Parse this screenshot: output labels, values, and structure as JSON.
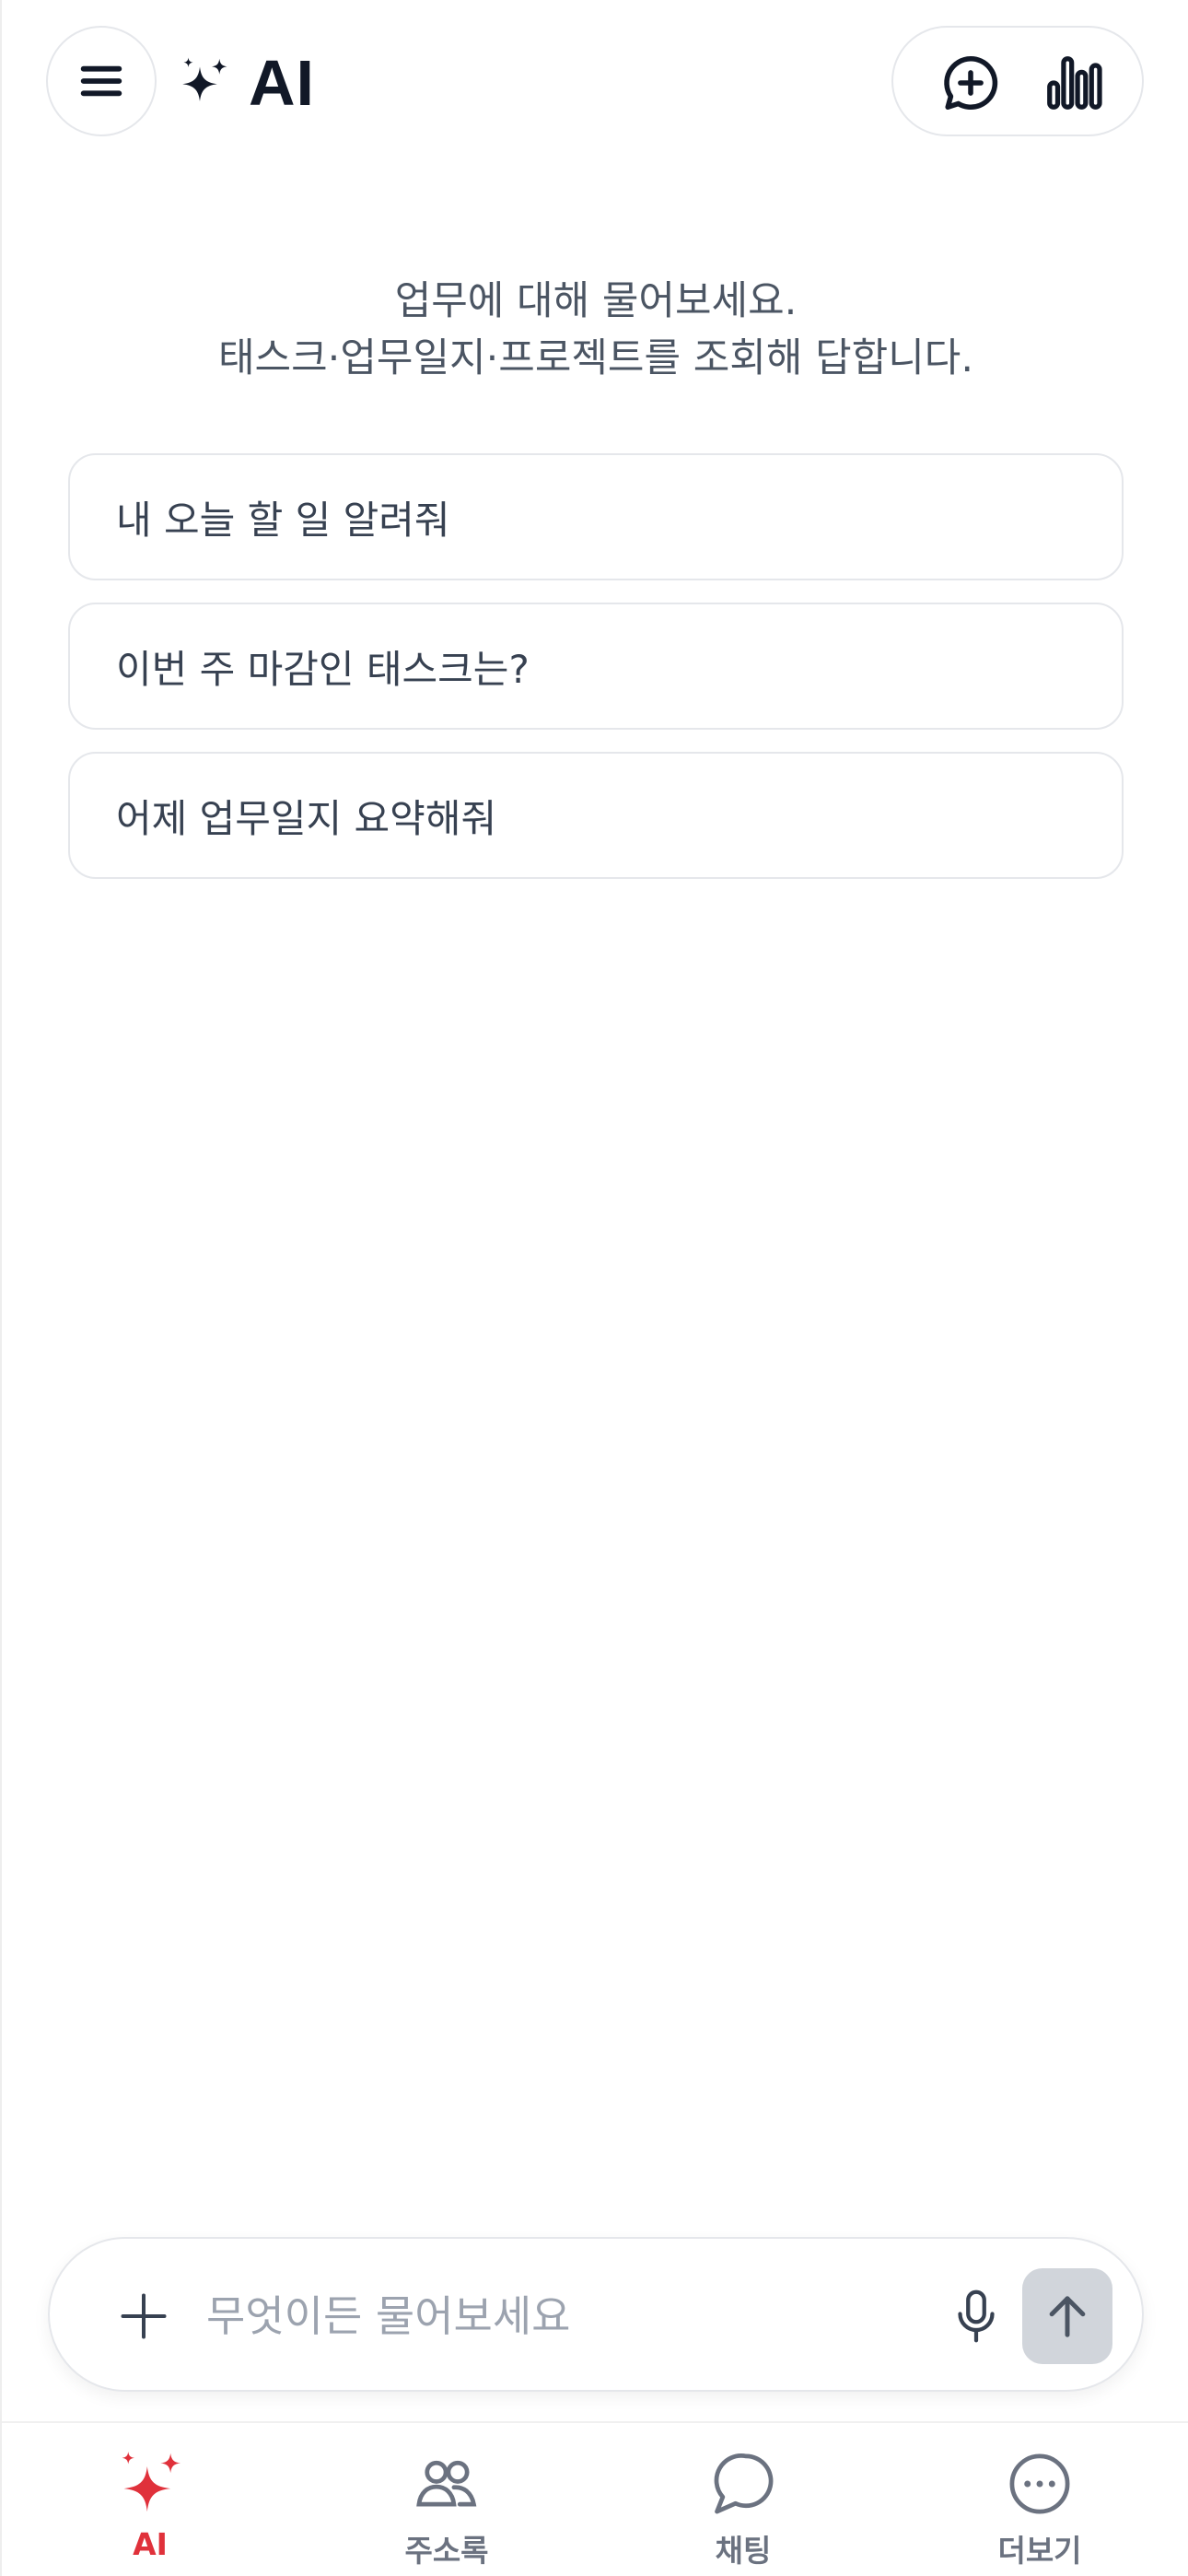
{
  "header": {
    "title": "AI",
    "menu_icon": "hamburger-menu-icon",
    "brand_icon": "sparkles-icon",
    "new_chat_icon": "chat-plus-icon",
    "stats_icon": "bar-chart-icon"
  },
  "intro": {
    "line1": "업무에 대해 물어보세요.",
    "line2": "태스크·업무일지·프로젝트를 조회해 답합니다."
  },
  "suggestions": [
    {
      "label": "내 오늘 할 일 알려줘"
    },
    {
      "label": "이번 주 마감인 태스크는?"
    },
    {
      "label": "어제 업무일지 요약해줘"
    }
  ],
  "composer": {
    "placeholder": "무엇이든 물어보세요",
    "value": "",
    "add_icon": "plus-icon",
    "mic_icon": "microphone-icon",
    "send_icon": "arrow-up-icon"
  },
  "bottom_nav": {
    "items": [
      {
        "label": "AI",
        "icon": "sparkles-icon",
        "active": true
      },
      {
        "label": "주소록",
        "icon": "people-icon",
        "active": false
      },
      {
        "label": "채팅",
        "icon": "chat-bubble-icon",
        "active": false
      },
      {
        "label": "더보기",
        "icon": "more-dots-icon",
        "active": false
      }
    ]
  },
  "colors": {
    "accent": "#e0313b",
    "text_primary": "#111827",
    "text_secondary": "#4b5563",
    "border": "#e5e7eb",
    "send_button_disabled": "#d1d5db"
  }
}
